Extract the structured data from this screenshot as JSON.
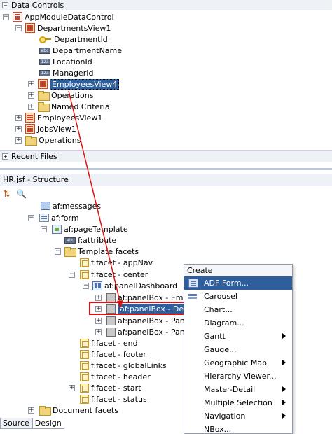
{
  "data_controls": {
    "panel_title": "Data Controls",
    "tree": {
      "root": "AppModuleDataControl",
      "departments_view": "DepartmentsView1",
      "attributes": [
        "DepartmentId",
        "DepartmentName",
        "LocationId",
        "ManagerId"
      ],
      "employees_view4": "EmployeesView4",
      "operations_inner": "Operations",
      "named_criteria": "Named Criteria",
      "employees_view1": "EmployeesView1",
      "jobs_view": "JobsView1",
      "operations_outer": "Operations"
    }
  },
  "recent_files": {
    "label": "Recent Files"
  },
  "structure": {
    "panel_title": "HR.jsf - Structure",
    "tree": {
      "messages": "af:messages",
      "form": "af:form",
      "page_template": "af:pageTemplate",
      "attribute": "f:attribute",
      "template_facets": "Template facets",
      "facet_appnav": "f:facet - appNav",
      "facet_center": "f:facet - center",
      "panel_dashboard": "af:panelDashboard",
      "panelbox_employ": "af:panelBox - Employ",
      "panelbox_details": "af:panelBox - Details",
      "panelbox_panelb1": "af:panelBox - PanelB",
      "panelbox_panelb2": "af:panelBox - PanelB",
      "facet_end": "f:facet - end",
      "facet_footer": "f:facet - footer",
      "facet_globallinks": "f:facet - globalLinks",
      "facet_header": "f:facet - header",
      "facet_start": "f:facet - start",
      "facet_status": "f:facet - status",
      "document_facets": "Document facets"
    },
    "tabs": [
      "Source",
      "Design"
    ],
    "active_tab": "Design"
  },
  "context_menu": {
    "title": "Create",
    "items": [
      {
        "label": "ADF Form...",
        "submenu": false
      },
      {
        "label": "Carousel",
        "submenu": false
      },
      {
        "label": "Chart...",
        "submenu": false
      },
      {
        "label": "Diagram...",
        "submenu": false
      },
      {
        "label": "Gantt",
        "submenu": true
      },
      {
        "label": "Gauge...",
        "submenu": false
      },
      {
        "label": "Geographic Map",
        "submenu": true
      },
      {
        "label": "Hierarchy Viewer...",
        "submenu": false
      },
      {
        "label": "Master-Detail",
        "submenu": true
      },
      {
        "label": "Multiple Selection",
        "submenu": true
      },
      {
        "label": "Navigation",
        "submenu": true
      },
      {
        "label": "NBox...",
        "submenu": false
      }
    ],
    "highlighted_index": 0
  },
  "colors": {
    "selection": "#2f5e9c",
    "drag_arrow": "#e01010",
    "panel_bg": "#eef1f6"
  }
}
